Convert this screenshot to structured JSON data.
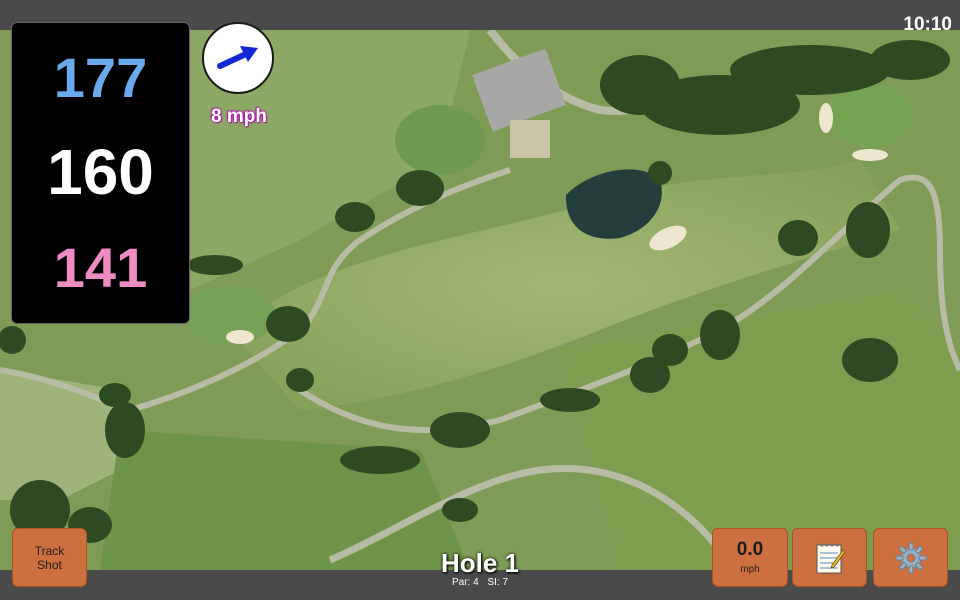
{
  "status": {
    "time": "10:10"
  },
  "distances": {
    "back": "177",
    "middle": "160",
    "front": "141"
  },
  "wind": {
    "speed_label": "8 mph",
    "icon": "wind-direction-arrow"
  },
  "hole": {
    "title": "Hole 1",
    "par": "Par: 4",
    "si": "SI: 7"
  },
  "buttons": {
    "track_shot": "Track\nShot",
    "speed_value": "0.0",
    "speed_unit": "mph",
    "note_icon": "notepad-icon",
    "settings_icon": "gear-icon"
  },
  "colors": {
    "back_distance": "#6aa9ec",
    "middle_distance": "#ffffff",
    "front_distance": "#f08cc4",
    "button_bg": "#cd6f3e",
    "bar_bg": "#4a4a4a"
  }
}
